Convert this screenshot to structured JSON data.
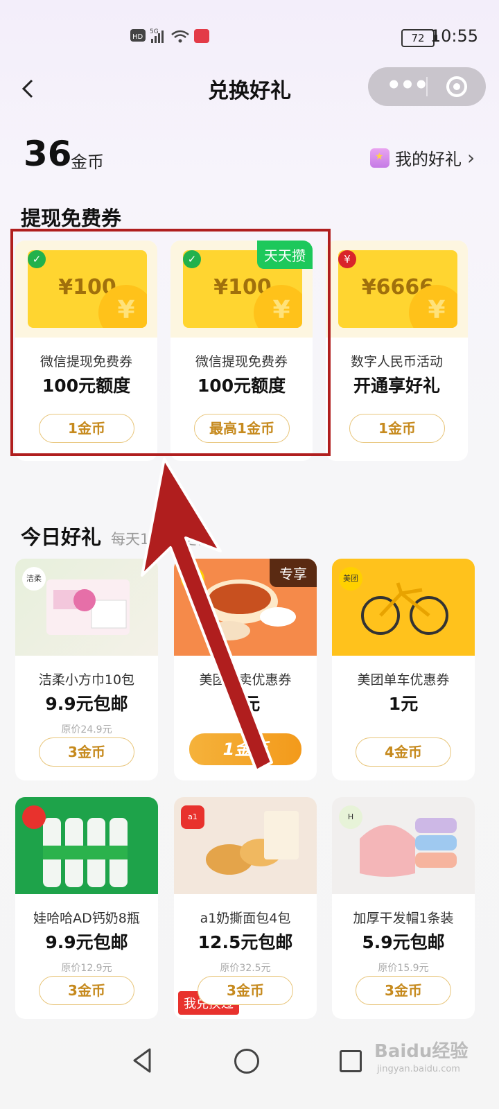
{
  "status_bar": {
    "time": "10:55",
    "battery": "72",
    "icons": [
      "hd-icon",
      "5g-signal-icon",
      "wifi-icon",
      "app-notification-icon"
    ]
  },
  "nav": {
    "title": "兑换好礼",
    "back_icon": "chevron-left-icon",
    "more_icon": "more-dots-icon",
    "close_icon": "target-ring-icon"
  },
  "balance": {
    "value": "36",
    "unit": "金币",
    "my_gifts_label": "我的好礼",
    "chevron": "›"
  },
  "withdraw_section": {
    "title": "提现免费券",
    "cards": [
      {
        "amount": "¥100",
        "line1": "微信提现免费券",
        "line2": "100元额度",
        "button": "1金币",
        "tag": "",
        "icon": "wechat-pay-icon"
      },
      {
        "amount": "¥100",
        "line1": "微信提现免费券",
        "line2": "100元额度",
        "button": "最高1金币",
        "tag": "天天攒",
        "icon": "wechat-pay-icon"
      },
      {
        "amount": "¥6666",
        "line1": "数字人民币活动",
        "line2": "开通享好礼",
        "button": "1金币",
        "tag": "",
        "icon": "digital-rmb-icon"
      }
    ]
  },
  "today_section": {
    "title": "今日好礼",
    "subtitle": "每天10:00更新",
    "items": [
      {
        "name": "洁柔小方巾10包",
        "price": "9.9元包邮",
        "original": "原价24.9元",
        "button": "3金币",
        "brand": "洁柔",
        "ribbon": ""
      },
      {
        "name": "美团外卖优惠券",
        "price": "3元",
        "original": "",
        "button": "1金币",
        "brand": "美团",
        "ribbon": "专享"
      },
      {
        "name": "美团单车优惠券",
        "price": "1元",
        "original": "",
        "button": "4金币",
        "brand": "美团",
        "ribbon": ""
      },
      {
        "name": "娃哈哈AD钙奶8瓶",
        "price": "9.9元包邮",
        "original": "原价12.9元",
        "button": "3金币",
        "brand": "",
        "ribbon": ""
      },
      {
        "name": "a1奶撕面包4包",
        "price": "12.5元包邮",
        "original": "原价32.5元",
        "button": "3金币",
        "brand": "a1",
        "ribbon": "我兑换过"
      },
      {
        "name": "加厚干发帽1条装",
        "price": "5.9元包邮",
        "original": "原价15.9元",
        "button": "3金币",
        "brand": "H",
        "ribbon": ""
      }
    ]
  },
  "watermark": {
    "text": "Baidu经验",
    "sub": "jingyan.baidu.com"
  },
  "colors": {
    "accent": "#c68a1e",
    "highlight_box": "#b01e1e",
    "arrow": "#b01e1e"
  }
}
